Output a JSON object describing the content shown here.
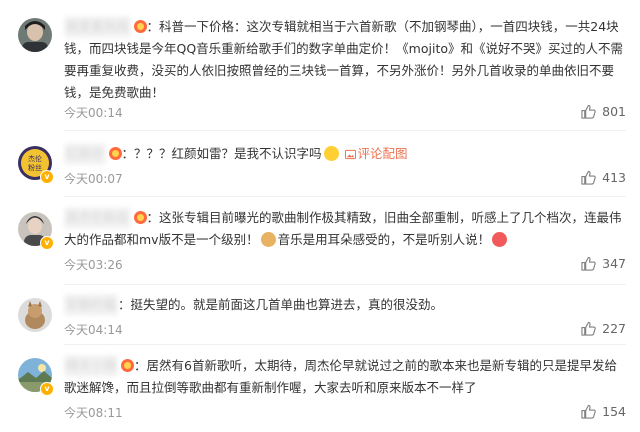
{
  "comments": [
    {
      "username": "我爱看热闹",
      "text": "：科普一下价格：这次专辑就相当于六首新歌（不加钢琴曲），一首四块钱，一共24块钱，而四块钱是今年QQ音乐重新给歌手们的数字单曲定价！《mojito》和《说好不哭》买过的人不需要再重复收费，没买的人依旧按照曾经的三块钱一首算，不另外涨价！另外几首收录的单曲依旧不要钱，是免费歌曲！",
      "time": "今天00:14",
      "likes": "801"
    },
    {
      "username": "红颜亦",
      "text": "：？？？红颜如雷？是我不认识字吗",
      "link": "评论配图",
      "time": "今天00:07",
      "likes": "413"
    },
    {
      "username": "周杰伦粉丝",
      "text_a": "：这张专辑目前曝光的歌曲制作极其精致，旧曲全部重制，听感上了几个档次，连最伟大的作品都和mv版不是一个级别！",
      "text_b": "音乐是用耳朵感受的，不是听别人说！",
      "time": "今天03:26",
      "likes": "347"
    },
    {
      "username": "安静的猫",
      "text": "：挺失望的。就是前面这几首单曲也算进去，真的很没劲。",
      "time": "今天04:14",
      "likes": "227"
    },
    {
      "username": "晴天小雨",
      "text": "：居然有6首新歌听，太期待，周杰伦早就说过之前的歌本来也是新专辑的只是提早发给歌迷解馋，而且拉倒等歌曲都有重新制作喔，大家去听和原来版本不一样了",
      "time": "今天08:11",
      "likes": "154"
    }
  ],
  "icons": {
    "like": "thumbs-up-icon",
    "verified": "verified-badge-icon",
    "fan": "fan-badge-icon",
    "image_link": "image-icon"
  },
  "colors": {
    "text": "#333333",
    "meta": "#999999",
    "link": "#eb7350",
    "divider": "#f0f0f0"
  }
}
